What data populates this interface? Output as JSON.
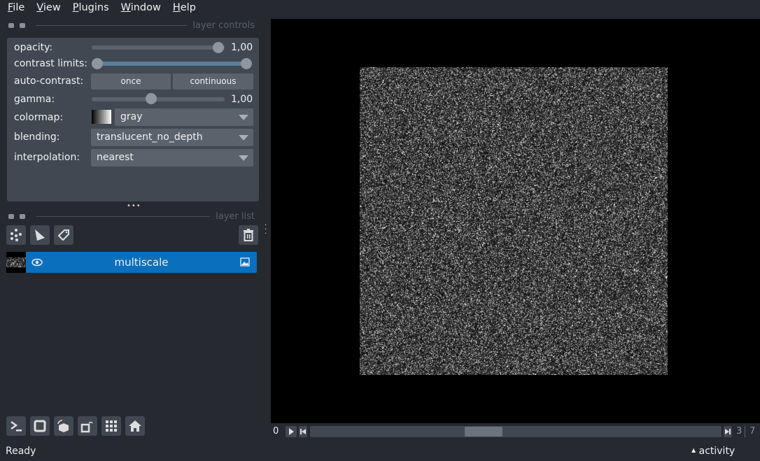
{
  "menu": [
    {
      "key": "F",
      "rest": "ile"
    },
    {
      "key": "V",
      "rest": "iew"
    },
    {
      "key": "P",
      "rest": "lugins"
    },
    {
      "key": "W",
      "rest": "indow"
    },
    {
      "key": "H",
      "rest": "elp"
    }
  ],
  "layer_controls": {
    "title": "layer controls",
    "opacity_label": "opacity:",
    "opacity_value": "1,00",
    "opacity_fraction": 1.0,
    "contrast_label": "contrast limits:",
    "contrast_range_fraction": [
      0.0,
      1.0
    ],
    "autocontrast_label": "auto-contrast:",
    "once_label": "once",
    "continuous_label": "continuous",
    "gamma_label": "gamma:",
    "gamma_value": "1,00",
    "colormap_label": "colormap:",
    "colormap_value": "gray",
    "blending_label": "blending:",
    "blending_value": "translucent_no_depth",
    "interpolation_label": "interpolation:",
    "interpolation_value": "nearest"
  },
  "layer_list": {
    "title": "layer list",
    "layers": [
      {
        "name": "multiscale",
        "visible": true,
        "type": "image"
      }
    ],
    "selected_color": "#0a6fbd"
  },
  "dims": {
    "current": "0",
    "value_a": "3",
    "value_b": "7"
  },
  "status": {
    "text": "Ready",
    "activity": "activity"
  },
  "icons": [
    "new-points-icon",
    "new-shapes-icon",
    "new-labels-icon",
    "delete-layer-icon",
    "console-icon",
    "ndisplay-square-icon",
    "roll-dims-icon",
    "transpose-icon",
    "grid-icon",
    "home-icon"
  ]
}
